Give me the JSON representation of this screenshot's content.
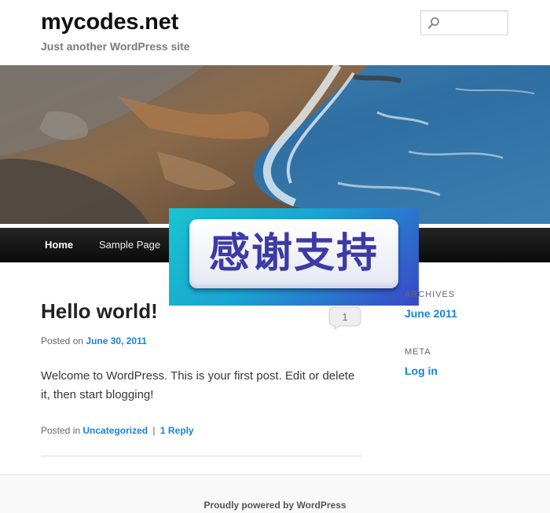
{
  "site": {
    "title": "mycodes.net",
    "description": "Just another WordPress site"
  },
  "search": {
    "placeholder": "",
    "icon": "search-icon"
  },
  "nav": {
    "items": [
      {
        "label": "Home",
        "active": true
      },
      {
        "label": "Sample Page",
        "active": false
      }
    ]
  },
  "overlay": {
    "text": "感谢支持"
  },
  "post": {
    "title": "Hello world!",
    "comment_count": "1",
    "posted_on_prefix": "Posted on",
    "date": "June 30, 2011",
    "content": "Welcome to WordPress. This is your first post. Edit or delete it, then start blogging!",
    "footer_prefix": "Posted in",
    "category": "Uncategorized",
    "separator": "|",
    "reply": "1 Reply"
  },
  "sidebar": {
    "archives_title": "ARCHIVES",
    "archive_link": "June 2011",
    "meta_title": "META",
    "login_link": "Log in"
  },
  "footer": {
    "text": "Proudly powered by WordPress"
  },
  "colors": {
    "link": "#1982d1",
    "nav_bg": "#1a1a1a",
    "overlay_cyan": "#19c4cf",
    "overlay_blue": "#3b46c8"
  }
}
